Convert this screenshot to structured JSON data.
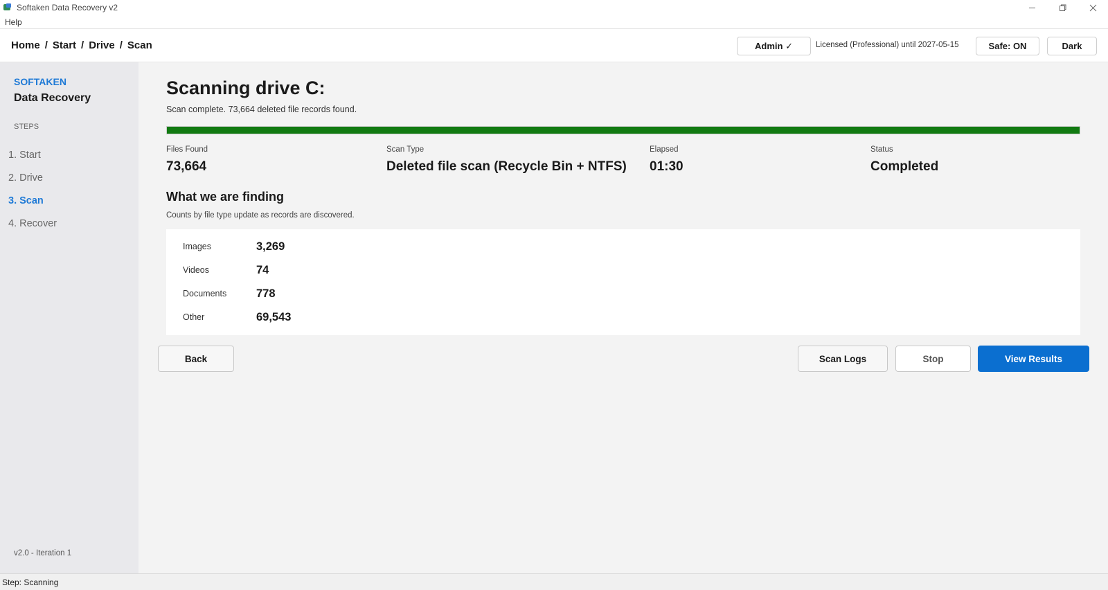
{
  "window": {
    "title": "Softaken Data Recovery v2"
  },
  "menu": {
    "items": [
      "Help"
    ]
  },
  "header": {
    "breadcrumb": [
      "Home",
      "Start",
      "Drive",
      "Scan"
    ],
    "separator": "/",
    "admin_label": "Admin ✓",
    "license_text": "Licensed (Professional) until 2027-05-15",
    "safe_label": "Safe: ON",
    "theme_label": "Dark"
  },
  "sidebar": {
    "brand_top": "SOFTAKEN",
    "brand_bottom": "Data Recovery",
    "steps_label": "STEPS",
    "steps": [
      {
        "label": "1. Start",
        "active": false
      },
      {
        "label": "2. Drive",
        "active": false
      },
      {
        "label": "3. Scan",
        "active": true
      },
      {
        "label": "4. Recover",
        "active": false
      }
    ],
    "version": "v2.0  -  Iteration 1"
  },
  "main": {
    "title": "Scanning drive C:",
    "subtitle": "Scan complete. 73,664 deleted file records found.",
    "progress": 1.0,
    "stats": [
      {
        "label": "Files Found",
        "value": "73,664"
      },
      {
        "label": "Scan Type",
        "value": "Deleted file scan (Recycle Bin + NTFS)"
      },
      {
        "label": "Elapsed",
        "value": "01:30"
      },
      {
        "label": "Status",
        "value": "Completed"
      }
    ],
    "finding_title": "What we are finding",
    "finding_sub": "Counts by file type update as records are discovered.",
    "findings": [
      {
        "label": "Images",
        "value": "3,269"
      },
      {
        "label": "Videos",
        "value": "74"
      },
      {
        "label": "Documents",
        "value": "778"
      },
      {
        "label": "Other",
        "value": "69,543"
      }
    ],
    "buttons": {
      "back": "Back",
      "scan_logs": "Scan Logs",
      "stop": "Stop",
      "view_results": "View Results"
    }
  },
  "statusbar": {
    "text": "Step: Scanning"
  },
  "colors": {
    "accent": "#1f7ad6",
    "primary_button": "#0b6fd0",
    "progress": "#117a11"
  },
  "icons": [
    "app-icon",
    "minimize-icon",
    "maximize-icon",
    "close-icon"
  ]
}
